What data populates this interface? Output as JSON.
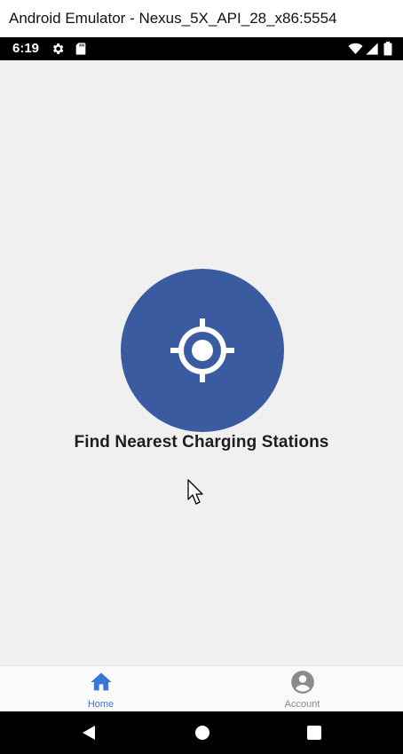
{
  "window": {
    "title": "Android Emulator - Nexus_5X_API_28_x86:5554"
  },
  "status_bar": {
    "time": "6:19",
    "left_icons": [
      "gear-icon",
      "sd-card-icon"
    ],
    "right_icons": [
      "wifi-icon",
      "cellular-signal-icon",
      "battery-icon"
    ]
  },
  "main": {
    "button_icon": "crosshair-location-icon",
    "cta_label": "Find Nearest Charging Stations",
    "button_color": "#3a5ba0"
  },
  "tabs": [
    {
      "label": "Home",
      "icon": "home-icon",
      "active": true,
      "color": "#3a76d6"
    },
    {
      "label": "Account",
      "icon": "account-circle-icon",
      "active": false,
      "color": "#8a8a8a"
    }
  ],
  "nav_bar": {
    "buttons": [
      "back-triangle-icon",
      "home-circle-icon",
      "recents-square-icon"
    ]
  }
}
